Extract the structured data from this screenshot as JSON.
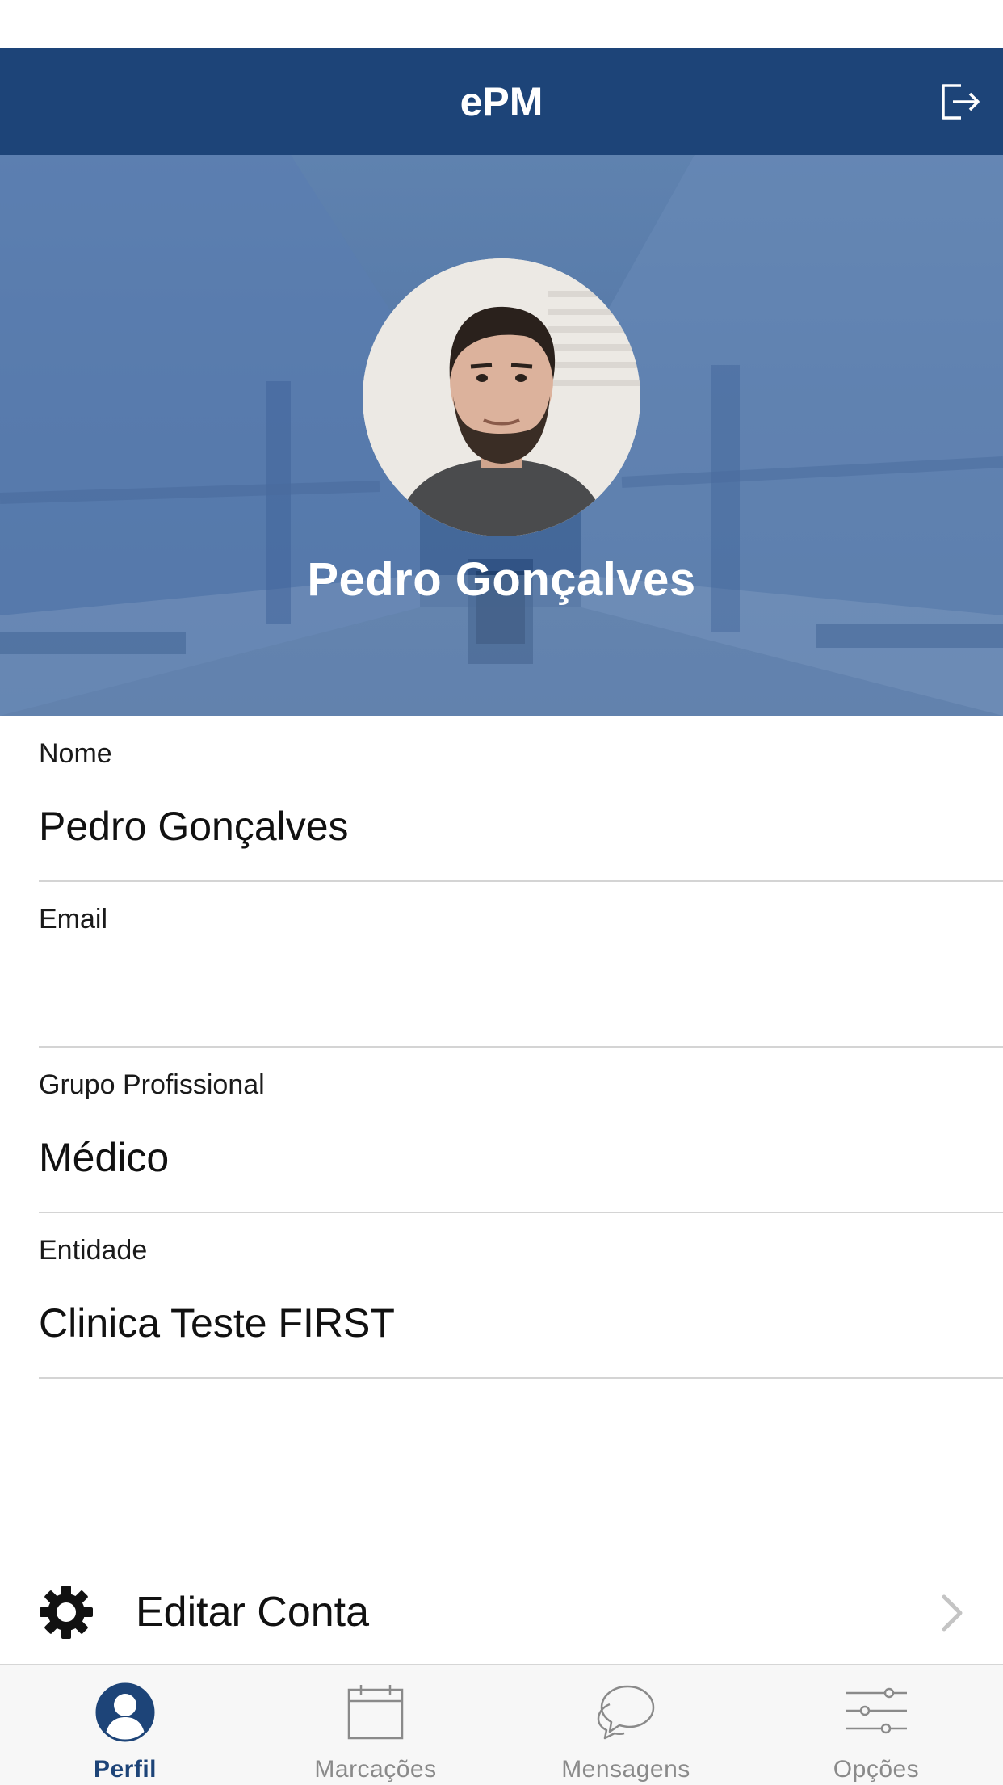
{
  "app": {
    "title": "ePM"
  },
  "header": {
    "logout_icon": "logout-icon"
  },
  "profile": {
    "name": "Pedro Gonçalves",
    "avatar_icon": "profile-photo"
  },
  "fields": [
    {
      "label": "Nome",
      "value": "Pedro Gonçalves"
    },
    {
      "label": "Email",
      "value": ""
    },
    {
      "label": "Grupo Profissional",
      "value": "Médico"
    },
    {
      "label": "Entidade",
      "value": "Clinica Teste FIRST"
    }
  ],
  "actions": {
    "edit_account": {
      "label": "Editar Conta",
      "icon": "gear-icon"
    }
  },
  "tabs": [
    {
      "label": "Perfil",
      "icon": "person-icon",
      "active": true
    },
    {
      "label": "Marcações",
      "icon": "calendar-icon",
      "active": false
    },
    {
      "label": "Mensagens",
      "icon": "chat-bubbles-icon",
      "active": false
    },
    {
      "label": "Opções",
      "icon": "sliders-icon",
      "active": false
    }
  ],
  "colors": {
    "primary": "#1d4478",
    "hero_overlay": "#5578a7",
    "tab_inactive": "#8a8a8a",
    "divider": "#d4d4d4"
  }
}
